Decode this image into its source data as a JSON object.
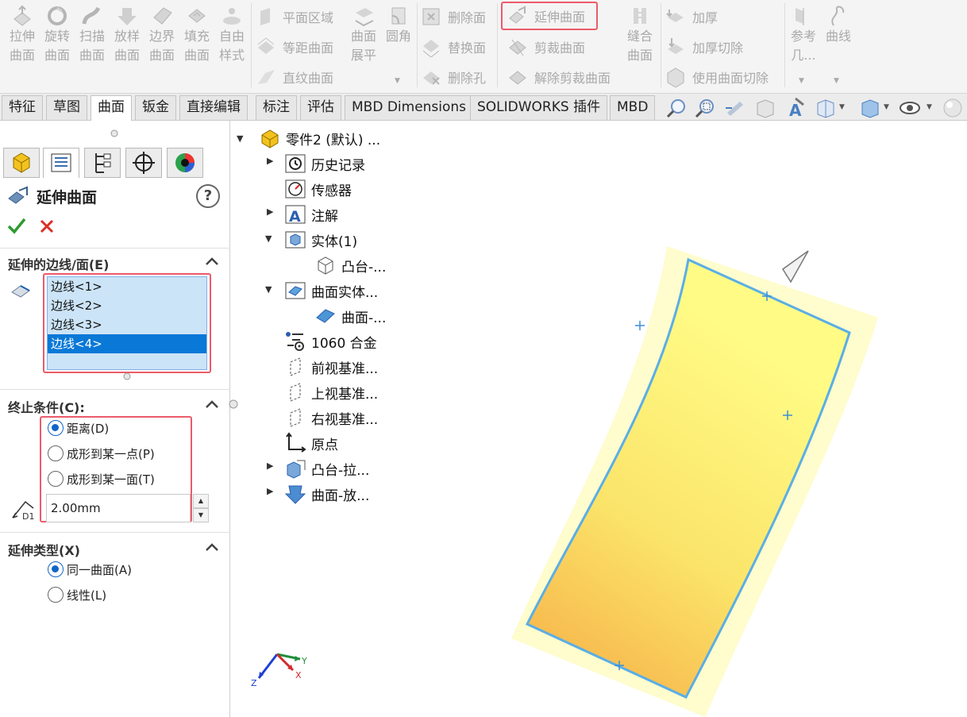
{
  "ribbon": {
    "large_buttons": [
      {
        "label1": "拉伸",
        "label2": "曲面",
        "icon": "extrude-surface-icon"
      },
      {
        "label1": "旋转",
        "label2": "曲面",
        "icon": "revolve-surface-icon"
      },
      {
        "label1": "扫描",
        "label2": "曲面",
        "icon": "sweep-surface-icon"
      },
      {
        "label1": "放样",
        "label2": "曲面",
        "icon": "loft-surface-icon"
      },
      {
        "label1": "边界",
        "label2": "曲面",
        "icon": "boundary-surface-icon"
      },
      {
        "label1": "填充",
        "label2": "曲面",
        "icon": "fill-surface-icon"
      },
      {
        "label1": "自由",
        "label2": "样式",
        "icon": "freeform-icon"
      }
    ],
    "planar_surface": "平面区域",
    "offset_surface": "等距曲面",
    "ruled_surface": "直纹曲面",
    "flatten_label1": "曲面",
    "flatten_label2": "展平",
    "fillet": "圆角",
    "delete_face": "删除面",
    "replace_face": "替换面",
    "delete_hole": "删除孔",
    "extend_surface": "延伸曲面",
    "trim_surface": "剪裁曲面",
    "untrim_surface": "解除剪裁曲面",
    "knit_label1": "缝合",
    "knit_label2": "曲面",
    "thicken": "加厚",
    "thickened_cut": "加厚切除",
    "cut_with_surface": "使用曲面切除",
    "ref_geom_label1": "参考",
    "ref_geom_label2": "几...",
    "curves": "曲线"
  },
  "tabs": [
    "特征",
    "草图",
    "曲面",
    "钣金",
    "直接编辑",
    "标注",
    "评估",
    "MBD Dimensions",
    "SOLIDWORKS 插件",
    "MBD"
  ],
  "active_tab": "曲面",
  "property_manager": {
    "title": "延伸曲面",
    "help_icon": "?",
    "section_edges": {
      "title": "延伸的边线/面(E)",
      "items": [
        "边线<1>",
        "边线<2>",
        "边线<3>",
        "边线<4>"
      ],
      "selected_index": 3
    },
    "section_end": {
      "title": "终止条件(C):",
      "options": [
        "距离(D)",
        "成形到某一点(P)",
        "成形到某一面(T)"
      ],
      "selected_index": 0,
      "distance_value": "2.00mm",
      "distance_icon_label": "D1"
    },
    "section_type": {
      "title": "延伸类型(X)",
      "options": [
        "同一曲面(A)",
        "线性(L)"
      ],
      "selected_index": 0
    }
  },
  "feature_tree": [
    {
      "label": "零件2 (默认) ...",
      "icon": "part-icon",
      "expanded": true
    },
    {
      "label": "历史记录",
      "icon": "history-icon",
      "expander": "collapsed"
    },
    {
      "label": "传感器",
      "icon": "sensor-icon"
    },
    {
      "label": "注解",
      "icon": "annotation-icon",
      "expander": "collapsed"
    },
    {
      "label": "实体(1)",
      "icon": "solid-bodies-icon",
      "expander": "expanded"
    },
    {
      "label": "凸台-...",
      "icon": "body-icon"
    },
    {
      "label": "曲面实体...",
      "icon": "surface-bodies-icon",
      "expander": "expanded"
    },
    {
      "label": "曲面-...",
      "icon": "surface-body-icon"
    },
    {
      "label": "1060 合金",
      "icon": "material-icon"
    },
    {
      "label": "前视基准...",
      "icon": "plane-icon"
    },
    {
      "label": "上视基准...",
      "icon": "plane-icon"
    },
    {
      "label": "右视基准...",
      "icon": "plane-icon"
    },
    {
      "label": "原点",
      "icon": "origin-icon"
    },
    {
      "label": "凸台-拉...",
      "icon": "extrude-feature-icon",
      "expander": "collapsed"
    },
    {
      "label": "曲面-放...",
      "icon": "loft-feature-icon",
      "expander": "collapsed"
    }
  ],
  "triad": {
    "x": "X",
    "y": "Y",
    "z": "Z"
  },
  "colors": {
    "highlight": "#ec5b6a",
    "selection": "#0a78d7",
    "surface": "#fff27a",
    "edge": "#5aaee6"
  }
}
